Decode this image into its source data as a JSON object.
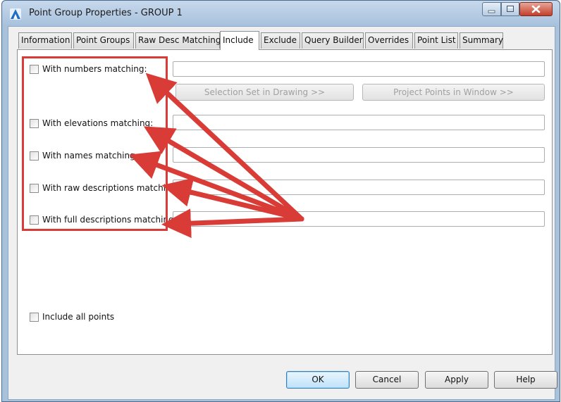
{
  "window": {
    "title": "Point Group Properties - GROUP 1"
  },
  "tabs": [
    {
      "label": "Information"
    },
    {
      "label": "Point Groups"
    },
    {
      "label": "Raw Desc Matching"
    },
    {
      "label": "Include"
    },
    {
      "label": "Exclude"
    },
    {
      "label": "Query Builder"
    },
    {
      "label": "Overrides"
    },
    {
      "label": "Point List"
    },
    {
      "label": "Summary"
    }
  ],
  "active_tab": "Include",
  "include": {
    "numbers": {
      "label": "With numbers matching:",
      "value": ""
    },
    "selection_set_button": "Selection Set in Drawing >>",
    "project_points_button": "Project Points in Window >>",
    "elevations": {
      "label": "With elevations matching:",
      "value": ""
    },
    "names": {
      "label": "With names matching:",
      "value": ""
    },
    "raw_descriptions": {
      "label": "With raw descriptions matching",
      "value": ""
    },
    "full_descriptions": {
      "label": "With full descriptions matching:",
      "value": ""
    },
    "include_all": {
      "label": "Include all points"
    }
  },
  "buttons": {
    "ok": "OK",
    "cancel": "Cancel",
    "apply": "Apply",
    "help": "Help"
  },
  "annotation": {
    "color": "#d93c36"
  }
}
